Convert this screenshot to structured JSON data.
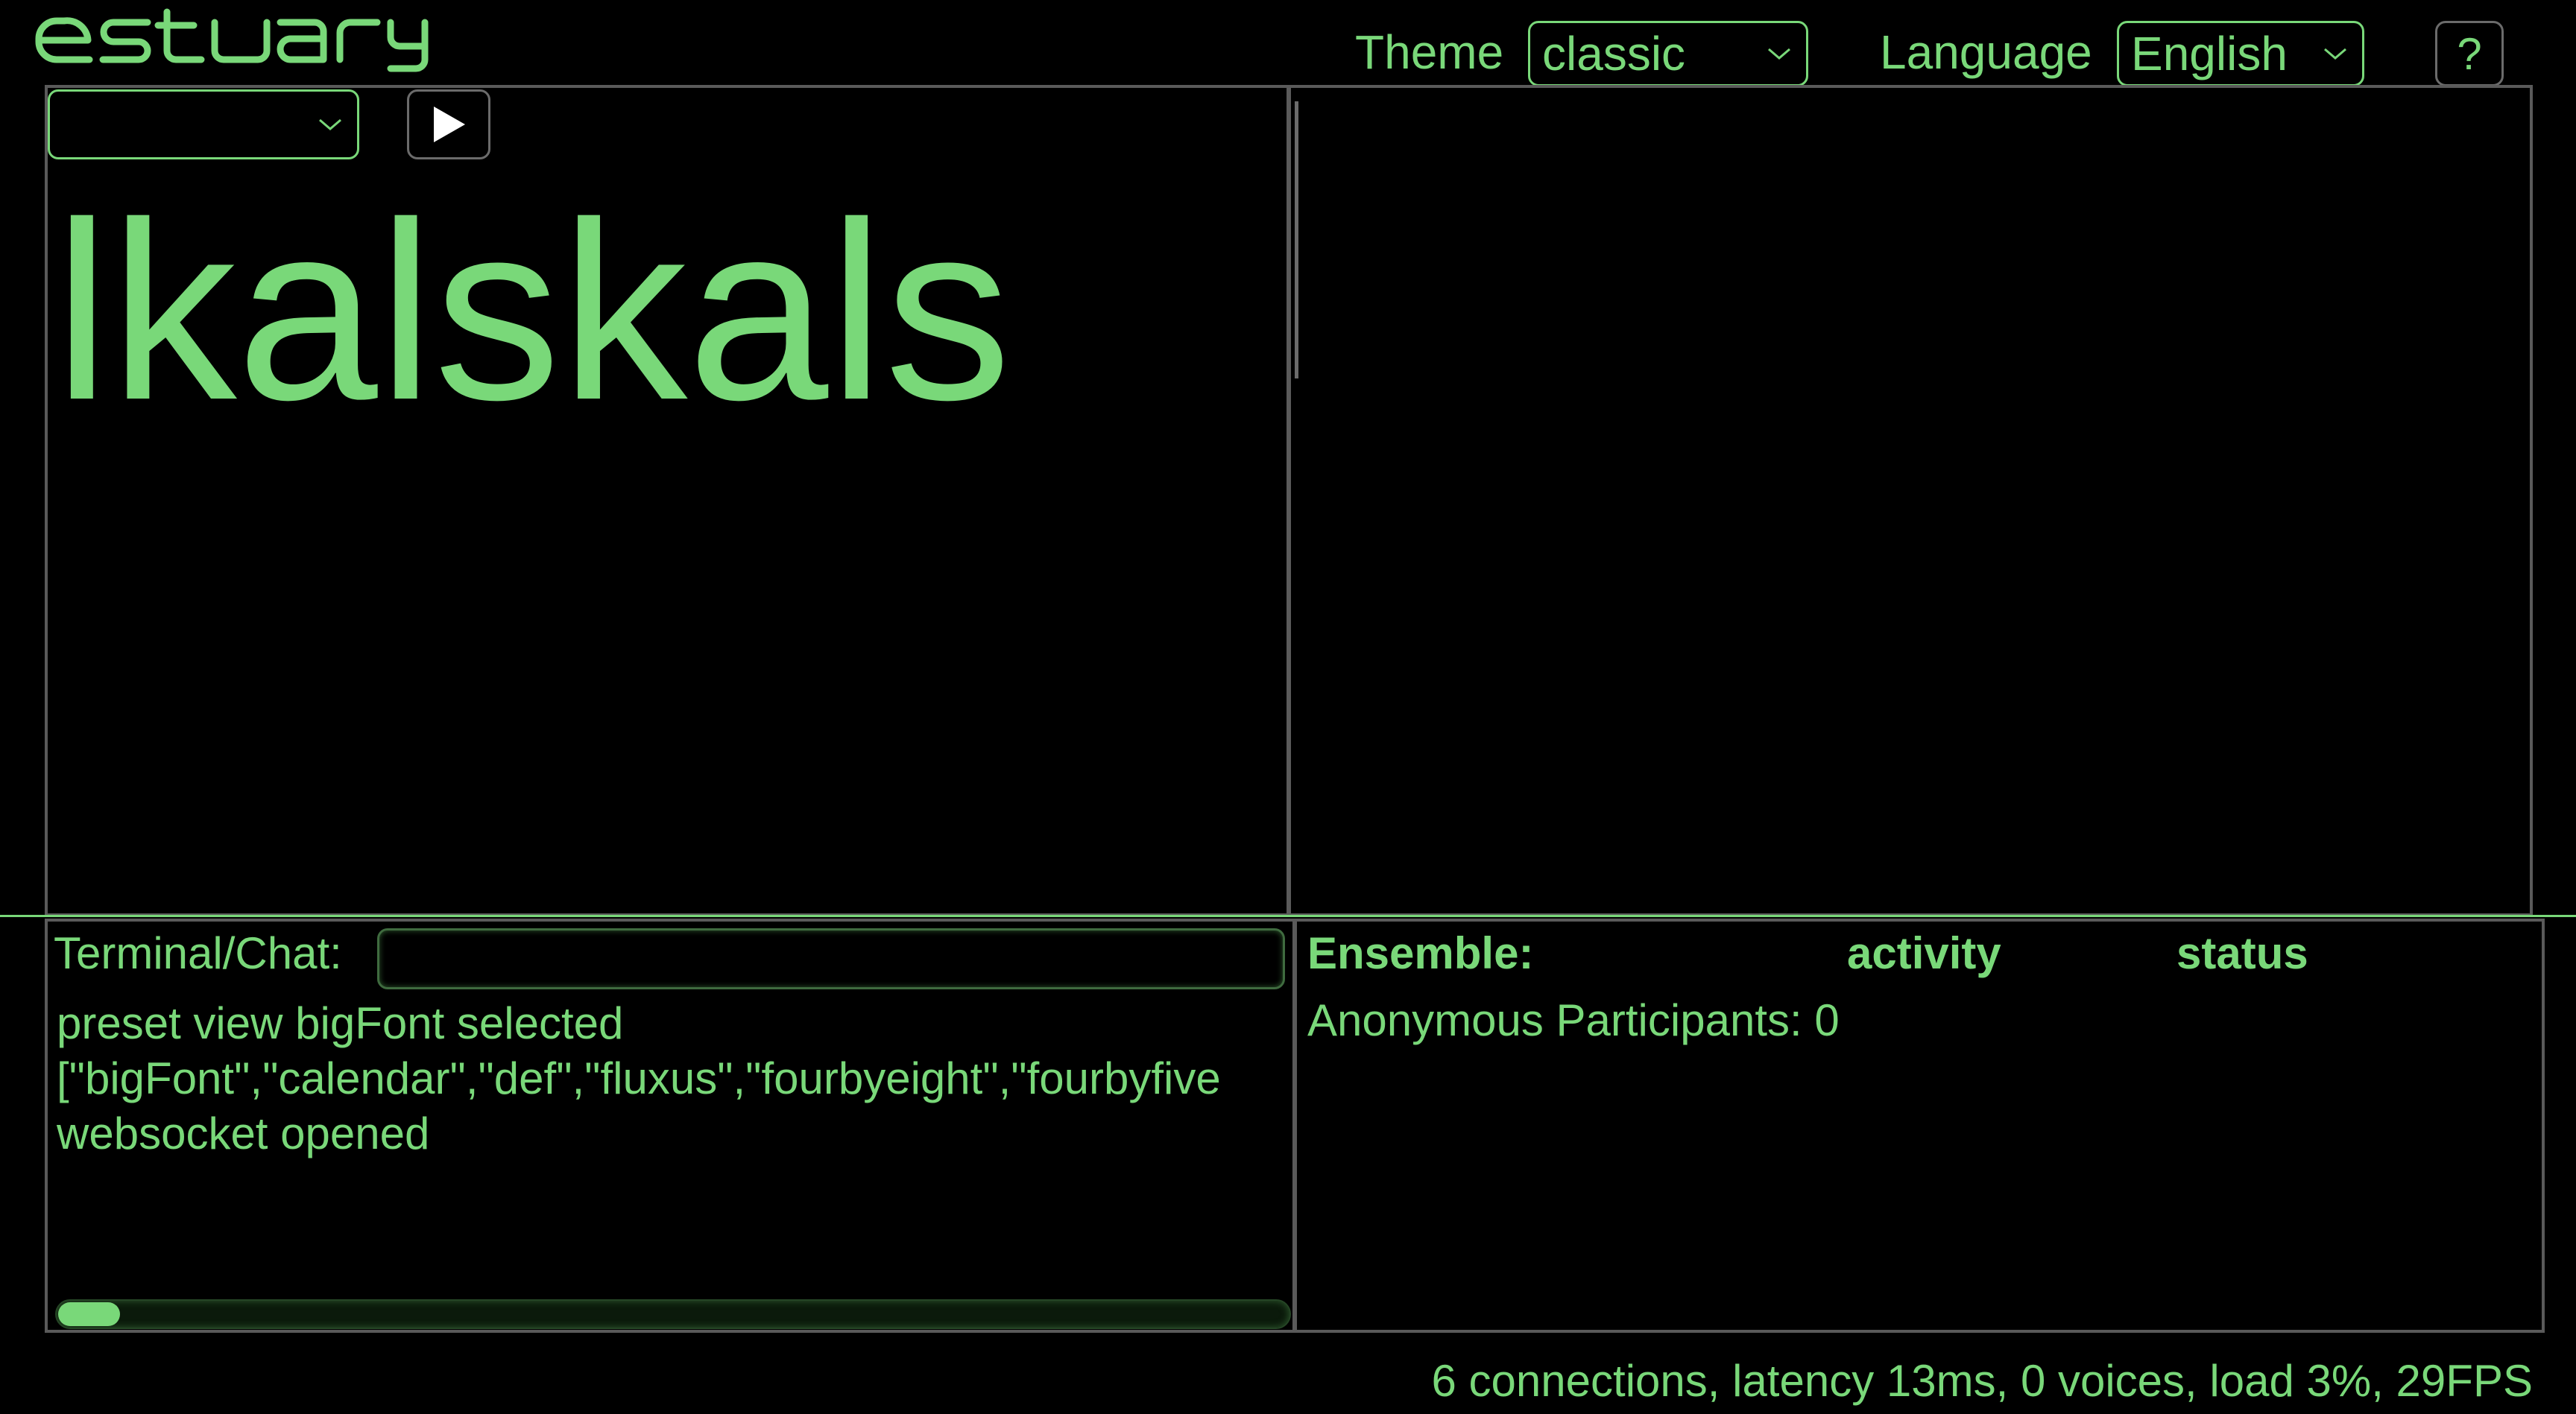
{
  "app": {
    "logo_text": "estuary"
  },
  "header": {
    "theme_label": "Theme",
    "theme_value": "classic",
    "language_label": "Language",
    "language_value": "English",
    "help_label": "?"
  },
  "editor": {
    "preset_value": "",
    "play_icon": "play-icon",
    "text": "lkalskals"
  },
  "terminal": {
    "label": "Terminal/Chat:",
    "input_value": "",
    "lines": [
      "preset view bigFont selected",
      "[\"bigFont\",\"calendar\",\"def\",\"fluxus\",\"fourbyeight\",\"fourbyfive",
      "websocket opened"
    ],
    "progress": 0.05
  },
  "ensemble": {
    "title": "Ensemble:",
    "col_activity": "activity",
    "col_status": "status",
    "anonymous": "Anonymous Participants: 0"
  },
  "status": {
    "text": "6 connections, latency 13ms, 0 voices, load 3%, 29FPS"
  },
  "colors": {
    "accent": "#79d879",
    "background": "#000000",
    "border": "#5a5a5a"
  }
}
